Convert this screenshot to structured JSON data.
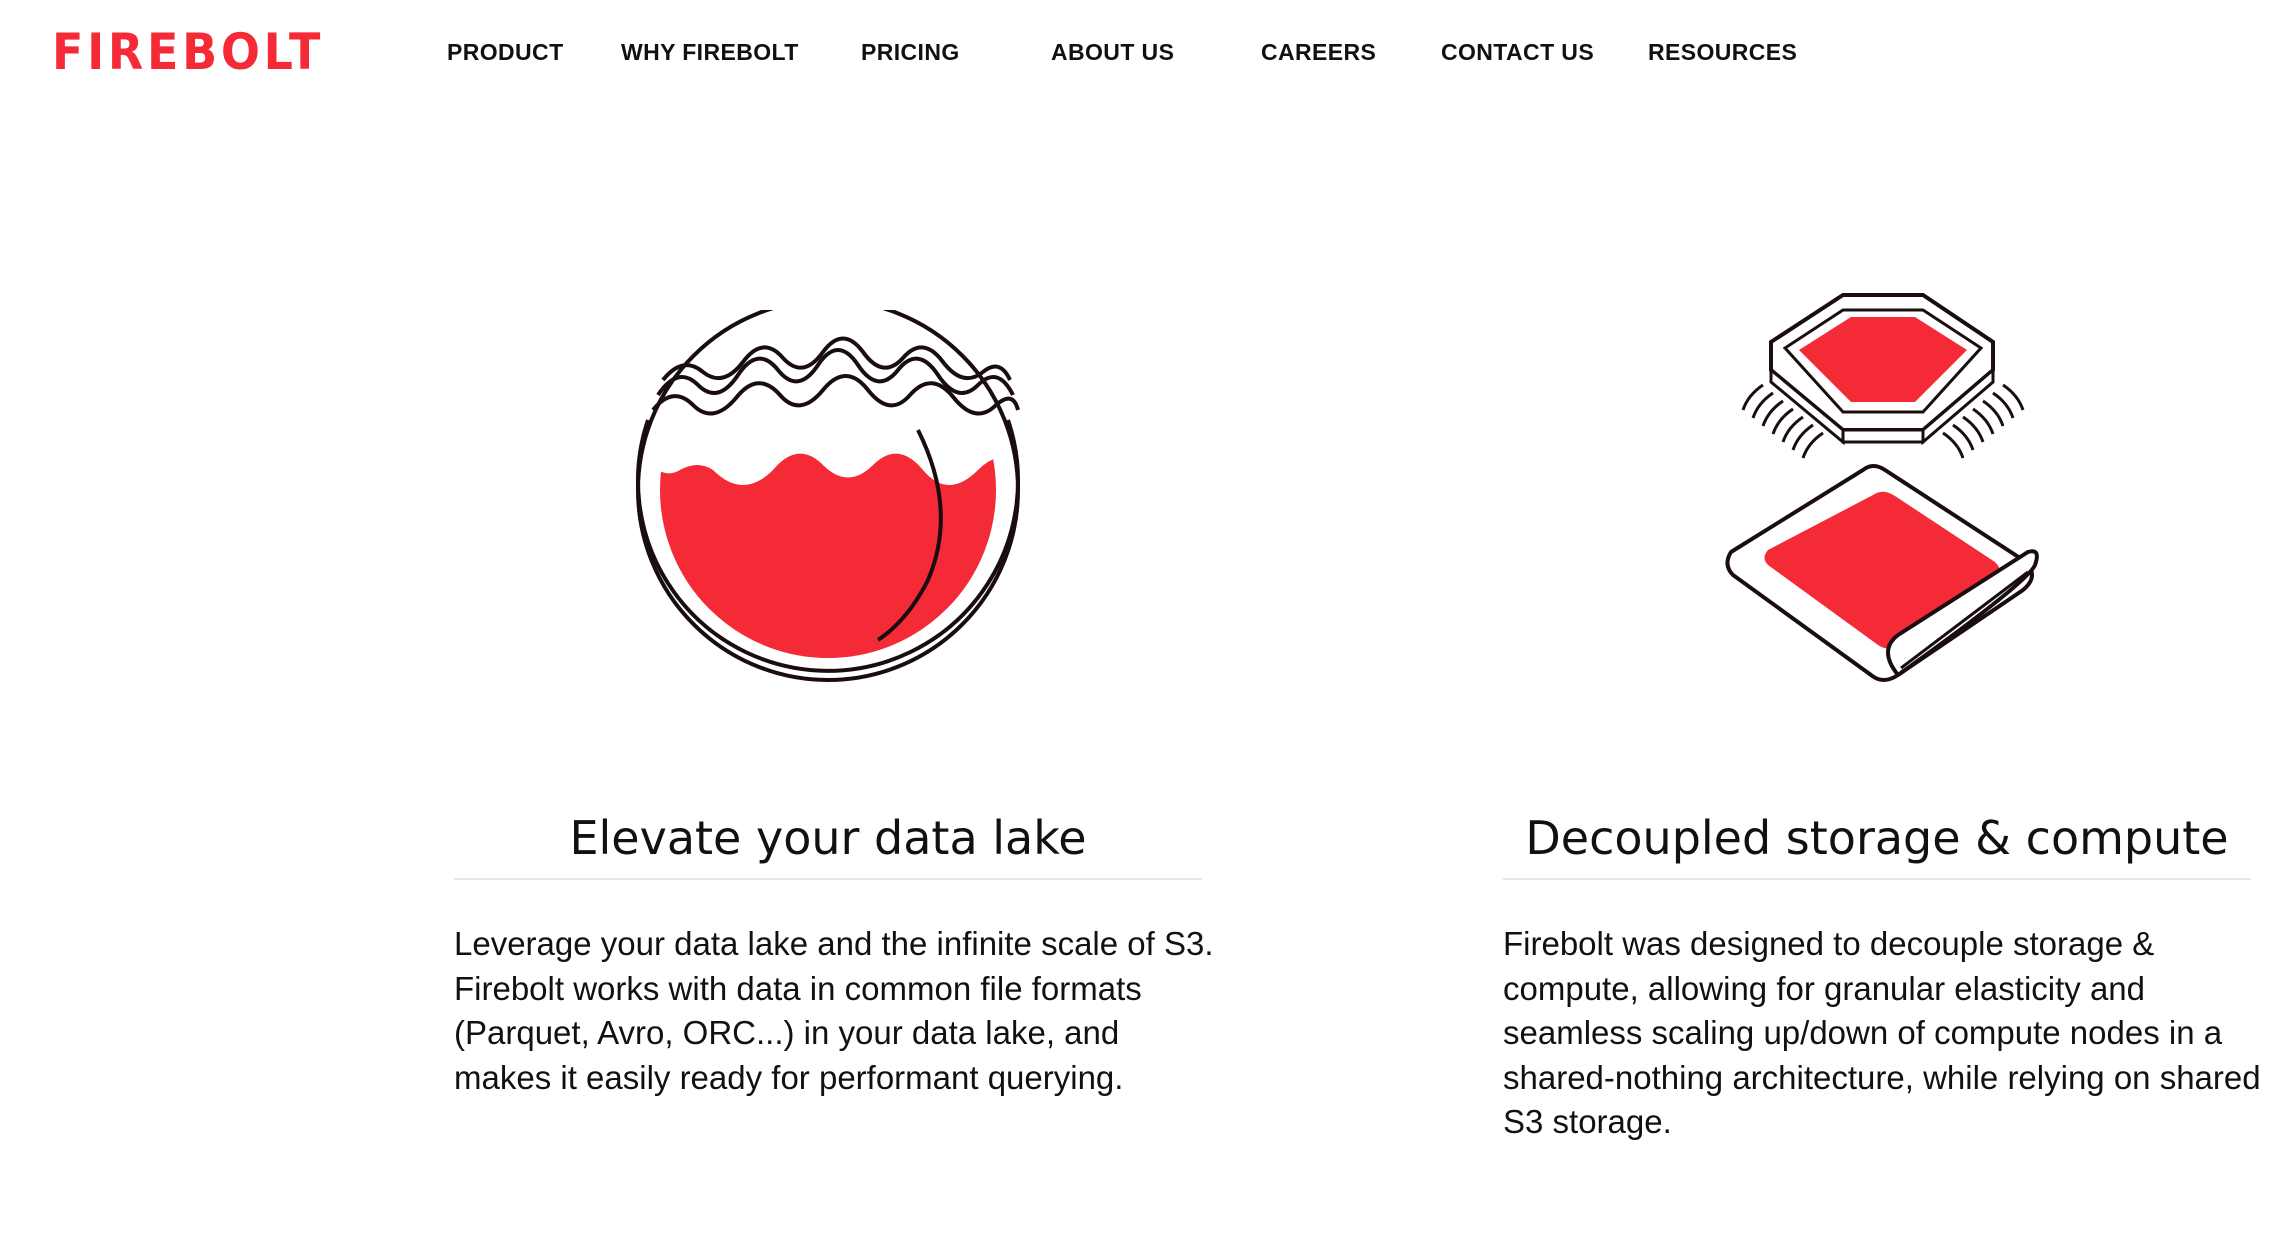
{
  "brand": {
    "name": "FIREBOLT",
    "accent_color": "#f42a36"
  },
  "nav": {
    "items": [
      {
        "label": "PRODUCT"
      },
      {
        "label": "WHY FIREBOLT"
      },
      {
        "label": "PRICING"
      },
      {
        "label": "ABOUT US"
      },
      {
        "label": "CAREERS"
      },
      {
        "label": "CONTACT US"
      },
      {
        "label": "RESOURCES"
      }
    ]
  },
  "features": [
    {
      "icon": "data-lake-bowl-icon",
      "title": "Elevate your data lake",
      "body": "Leverage your data lake and the infinite scale of S3. Firebolt works with data in common file formats (Parquet, Avro, ORC...) in your data lake, and makes it easily ready for performant querying."
    },
    {
      "icon": "chip-and-storage-icon",
      "title": "Decoupled storage & compute",
      "body": "Firebolt was designed to decouple storage & compute, allowing for granular elasticity and seamless scaling up/down of compute nodes in a shared-nothing architecture, while relying on shared S3 storage."
    }
  ]
}
